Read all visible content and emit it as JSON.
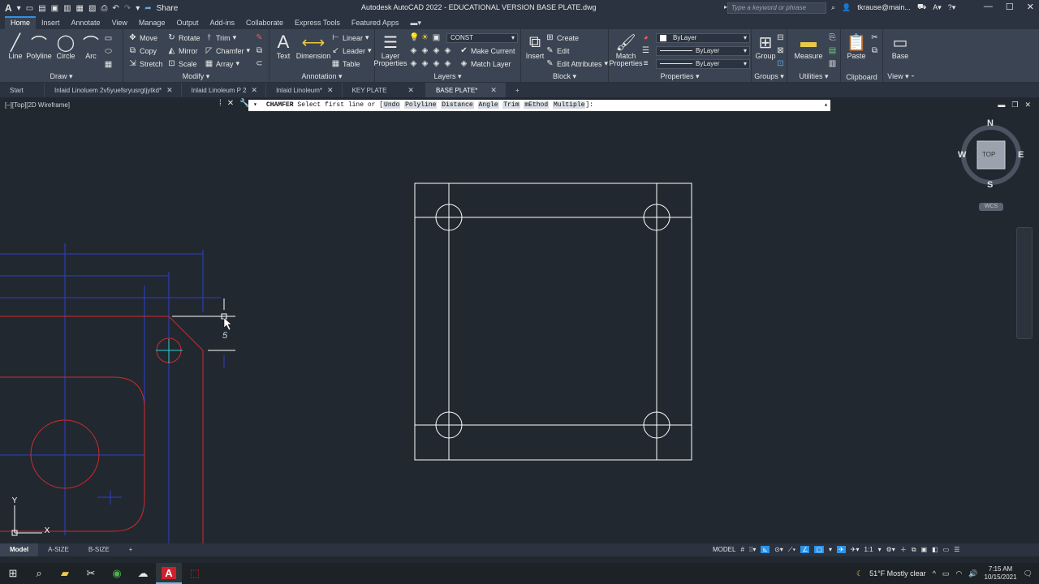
{
  "titlebar": {
    "title": "Autodesk AutoCAD 2022 - EDUCATIONAL VERSION    BASE PLATE.dwg",
    "share_label": "Share",
    "search_placeholder": "Type a keyword or phrase",
    "user": "tkrause@main..."
  },
  "menu_tabs": [
    "Home",
    "Insert",
    "Annotate",
    "View",
    "Manage",
    "Output",
    "Add-ins",
    "Collaborate",
    "Express Tools",
    "Featured Apps"
  ],
  "ribbon": {
    "draw": {
      "title": "Draw",
      "line": "Line",
      "polyline": "Polyline",
      "circle": "Circle",
      "arc": "Arc"
    },
    "modify": {
      "title": "Modify",
      "move": "Move",
      "rotate": "Rotate",
      "trim": "Trim",
      "copy": "Copy",
      "mirror": "Mirror",
      "chamfer": "Chamfer",
      "stretch": "Stretch",
      "scale": "Scale",
      "array": "Array"
    },
    "annotation": {
      "title": "Annotation",
      "text": "Text",
      "dimension": "Dimension",
      "linear": "Linear",
      "leader": "Leader",
      "table": "Table"
    },
    "layers": {
      "title": "Layers",
      "layer_properties": "Layer Properties",
      "current_layer": "CONST",
      "make_current": "Make Current",
      "match_layer": "Match Layer"
    },
    "block": {
      "title": "Block",
      "insert": "Insert",
      "create": "Create",
      "edit": "Edit",
      "edit_attributes": "Edit Attributes"
    },
    "properties": {
      "title": "Properties",
      "match_properties": "Match Properties",
      "color": "ByLayer",
      "linetype": "ByLayer",
      "lineweight": "ByLayer"
    },
    "groups": {
      "title": "Groups",
      "group": "Group"
    },
    "utilities": {
      "title": "Utilities",
      "measure": "Measure"
    },
    "clipboard": {
      "title": "Clipboard",
      "paste": "Paste"
    },
    "view": {
      "title": "View",
      "base": "Base"
    }
  },
  "doc_tabs": [
    {
      "label": "Start",
      "active": false
    },
    {
      "label": "Inlaid Linoluem 2v5yuefsryusrgtjytkd*",
      "active": false
    },
    {
      "label": "Inlaid Linoleum P 2",
      "active": false
    },
    {
      "label": "Inlaid Linoleum*",
      "active": false
    },
    {
      "label": "KEY PLATE",
      "active": false
    },
    {
      "label": "BASE PLATE*",
      "active": true
    }
  ],
  "viewport": {
    "label": "[–][Top][2D Wireframe]",
    "command_name": "CHAMFER",
    "command_prompt": "Select first line or [",
    "command_options": [
      "Undo",
      "Polyline",
      "Distance",
      "Angle",
      "Trim",
      "mEthod",
      "Multiple"
    ],
    "command_suffix": "]:",
    "viewcube": {
      "n": "N",
      "s": "S",
      "e": "E",
      "w": "W",
      "face": "TOP"
    },
    "wcs_label": "WCS",
    "ucs_x": "X",
    "ucs_y": "Y"
  },
  "layout_tabs": [
    {
      "label": "Model",
      "active": true
    },
    {
      "label": "A-SIZE",
      "active": false
    },
    {
      "label": "B-SIZE",
      "active": false
    }
  ],
  "status": {
    "model": "MODEL",
    "scale": "1:1"
  },
  "taskbar": {
    "weather": "51°F  Mostly clear",
    "time": "7:15 AM",
    "date": "10/15/2021"
  },
  "colors": {
    "accent": "#2e93e6",
    "ribbon_bg": "#3b4452",
    "canvas_bg": "#212830",
    "red_geom": "#d02b2b",
    "blue_dim": "#2a3fd0"
  }
}
